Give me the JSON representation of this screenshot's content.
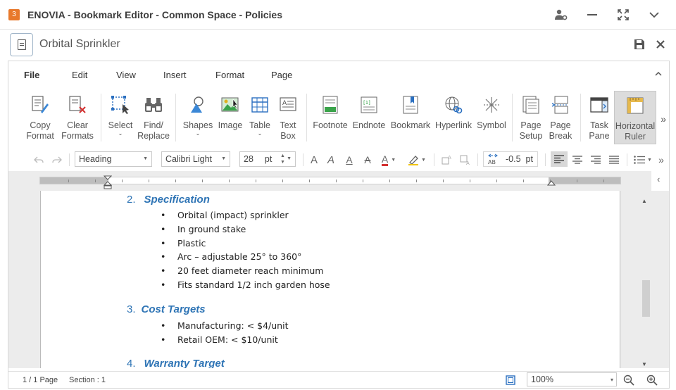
{
  "window": {
    "title": "ENOVIA - Bookmark Editor - Common Space - Policies"
  },
  "document": {
    "name": "Orbital Sprinkler"
  },
  "menu": {
    "tabs": [
      {
        "label": "File"
      },
      {
        "label": "Edit"
      },
      {
        "label": "View"
      },
      {
        "label": "Insert"
      },
      {
        "label": "Format"
      },
      {
        "label": "Page"
      }
    ]
  },
  "ribbon": {
    "copy_format": [
      "Copy",
      "Format"
    ],
    "clear_formats": [
      "Clear",
      "Formats"
    ],
    "select": "Select",
    "find_replace": [
      "Find/",
      "Replace"
    ],
    "shapes": "Shapes",
    "image": "Image",
    "table": "Table",
    "text_box": [
      "Text",
      "Box"
    ],
    "footnote": "Footnote",
    "endnote": "Endnote",
    "bookmark": "Bookmark",
    "hyperlink": "Hyperlink",
    "symbol": "Symbol",
    "page_setup": [
      "Page",
      "Setup"
    ],
    "page_break": [
      "Page",
      "Break"
    ],
    "task_pane": [
      "Task",
      "Pane"
    ],
    "horizontal_ruler": [
      "Horizontal",
      "Ruler"
    ]
  },
  "format_bar": {
    "style": "Heading",
    "font": "Calibri Light",
    "size": "28",
    "size_unit": "pt",
    "spacing": "-0.5",
    "spacing_unit": "pt"
  },
  "content": {
    "sections": [
      {
        "number": "2.",
        "title": "Specification",
        "items": [
          "Orbital (impact) sprinkler",
          "In ground stake",
          "Plastic",
          "Arc – adjustable 25° to 360°",
          "20 feet diameter reach minimum",
          "Fits standard 1/2 inch garden hose"
        ]
      },
      {
        "number": "3.",
        "title": "Cost Targets",
        "items": [
          "Manufacturing: < $4/unit",
          "Retail OEM: < $10/unit"
        ]
      },
      {
        "number": "4.",
        "title": "Warranty Target",
        "items": []
      }
    ]
  },
  "status": {
    "page": "1 / 1 Page",
    "section": "Section : 1",
    "zoom": "100%"
  },
  "colors": {
    "heading": "#2e74b5",
    "logo": "#e8792b"
  }
}
